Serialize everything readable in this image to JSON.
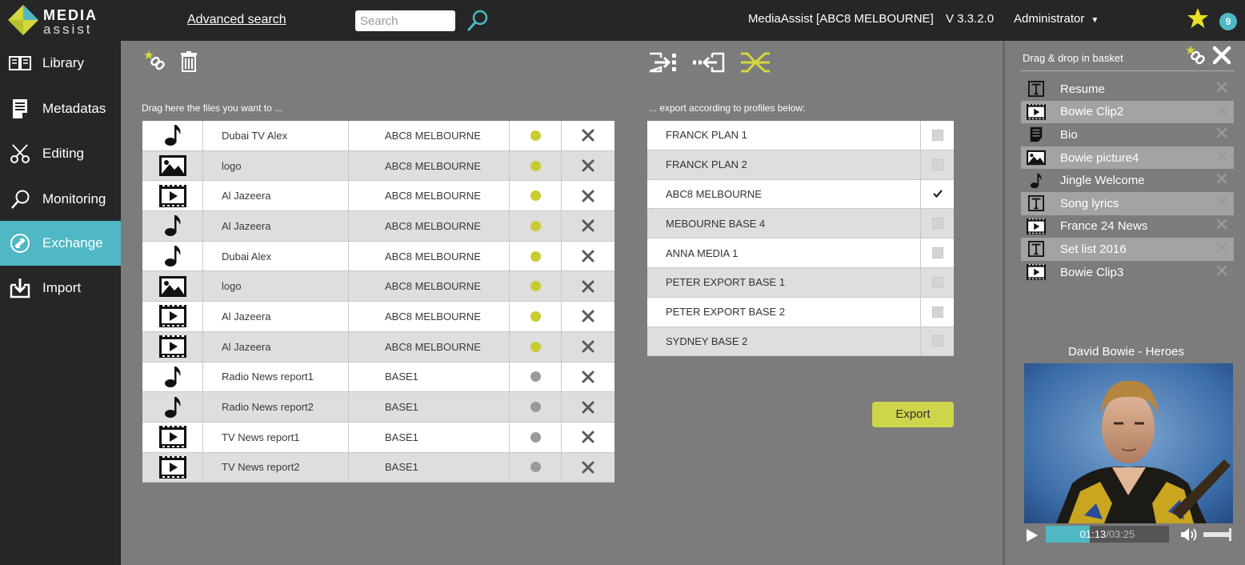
{
  "header": {
    "logo_top": "MEDIA",
    "logo_bottom": "assist",
    "advanced_search": "Advanced search",
    "search_placeholder": "Search",
    "app_title": "MediaAssist [ABC8 MELBOURNE]",
    "version": "V 3.3.2.0",
    "user": "Administrator",
    "badge_count": "9"
  },
  "sidebar": {
    "items": [
      {
        "label": "Library",
        "icon": "book-icon",
        "active": false
      },
      {
        "label": "Metadatas",
        "icon": "document-icon",
        "active": false
      },
      {
        "label": "Editing",
        "icon": "scissors-icon",
        "active": false
      },
      {
        "label": "Monitoring",
        "icon": "magnifier-icon",
        "active": false
      },
      {
        "label": "Exchange",
        "icon": "exchange-icon",
        "active": true
      },
      {
        "label": "Import",
        "icon": "import-icon",
        "active": false
      }
    ]
  },
  "main": {
    "files_label": "Drag here the files you want to ...",
    "profiles_label": "... export according to profiles below:",
    "files": [
      {
        "type": "audio",
        "name": "Dubai TV Alex",
        "base": "ABC8 MELBOURNE",
        "status": "active"
      },
      {
        "type": "image",
        "name": "logo",
        "base": "ABC8 MELBOURNE",
        "status": "active"
      },
      {
        "type": "video",
        "name": "Al Jazeera",
        "base": "ABC8 MELBOURNE",
        "status": "active"
      },
      {
        "type": "audio",
        "name": "Al Jazeera",
        "base": "ABC8 MELBOURNE",
        "status": "active"
      },
      {
        "type": "audio",
        "name": "Dubai  Alex",
        "base": "ABC8 MELBOURNE",
        "status": "active"
      },
      {
        "type": "image",
        "name": "logo",
        "base": "ABC8 MELBOURNE",
        "status": "active"
      },
      {
        "type": "video",
        "name": "Al Jazeera",
        "base": "ABC8 MELBOURNE",
        "status": "active"
      },
      {
        "type": "video",
        "name": "Al Jazeera",
        "base": "ABC8 MELBOURNE",
        "status": "active"
      },
      {
        "type": "audio",
        "name": "Radio News report1",
        "base": "BASE1",
        "status": "inactive"
      },
      {
        "type": "audio",
        "name": "Radio News report2",
        "base": "BASE1",
        "status": "inactive"
      },
      {
        "type": "video",
        "name": "TV News report1",
        "base": "BASE1",
        "status": "inactive"
      },
      {
        "type": "video",
        "name": "TV News report2",
        "base": "BASE1",
        "status": "inactive"
      }
    ],
    "profiles": [
      {
        "name": "FRANCK PLAN 1",
        "checked": false
      },
      {
        "name": "FRANCK PLAN 2",
        "checked": false
      },
      {
        "name": "ABC8 MELBOURNE",
        "checked": true
      },
      {
        "name": "MEBOURNE BASE 4",
        "checked": false
      },
      {
        "name": "ANNA MEDIA 1",
        "checked": false
      },
      {
        "name": "PETER EXPORT BASE 1",
        "checked": false
      },
      {
        "name": "PETER EXPORT BASE 2",
        "checked": false
      },
      {
        "name": "SYDNEY BASE 2",
        "checked": false
      }
    ],
    "export_label": "Export"
  },
  "basket": {
    "title": "Drag & drop in basket",
    "items": [
      {
        "type": "text",
        "label": "Resume"
      },
      {
        "type": "video",
        "label": "Bowie Clip2"
      },
      {
        "type": "document",
        "label": "Bio"
      },
      {
        "type": "image",
        "label": "Bowie picture4"
      },
      {
        "type": "audio",
        "label": "Jingle Welcome"
      },
      {
        "type": "text",
        "label": "Song lyrics"
      },
      {
        "type": "video",
        "label": "France 24 News"
      },
      {
        "type": "text",
        "label": "Set list 2016"
      },
      {
        "type": "video",
        "label": "Bowie Clip3"
      }
    ],
    "video_title": "David Bowie - Heroes",
    "time_current": "01:13",
    "time_total": "/03:25",
    "progress_fraction": 0.357,
    "volume_fraction": 1.0
  },
  "colors": {
    "accent": "#4fb8c4",
    "status_active": "#c9cc30",
    "status_inactive": "#9a9a9a",
    "export_button": "#ced54a"
  }
}
